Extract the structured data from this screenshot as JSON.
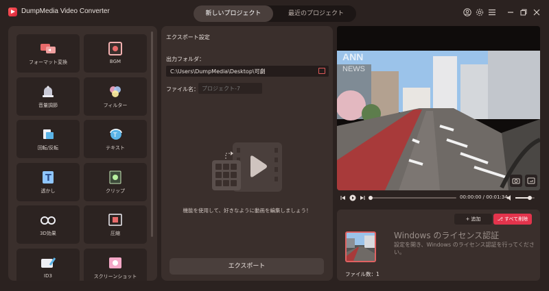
{
  "app": {
    "title": "DumpMedia Video Converter"
  },
  "tabs": [
    {
      "label": "新しいプロジェクト",
      "active": true
    },
    {
      "label": "最近のプロジェクト",
      "active": false
    }
  ],
  "window_icons": [
    "user-icon",
    "gear-icon",
    "menu-icon",
    "minimize-icon",
    "maximize-icon",
    "close-icon"
  ],
  "tools": [
    {
      "label": "フォーマット変換",
      "icon": "format-convert-icon"
    },
    {
      "label": "BGM",
      "icon": "bgm-icon"
    },
    {
      "label": "音量調節",
      "icon": "volume-bell-icon"
    },
    {
      "label": "フィルター",
      "icon": "filter-icon"
    },
    {
      "label": "回転/反転",
      "icon": "rotate-icon"
    },
    {
      "label": "テキスト",
      "icon": "text-icon"
    },
    {
      "label": "透かし",
      "icon": "watermark-icon"
    },
    {
      "label": "クリップ",
      "icon": "crop-icon"
    },
    {
      "label": "3D効果",
      "icon": "3d-glasses-icon"
    },
    {
      "label": "圧縮",
      "icon": "compress-icon"
    },
    {
      "label": "ID3",
      "icon": "id3-icon"
    },
    {
      "label": "スクリーンショット",
      "icon": "screenshot-icon"
    }
  ],
  "export": {
    "section_title": "エクスポート設定",
    "folder_label": "出力フォルダ：",
    "folder_path": "C:\\Users\\DumpMedia\\Desktop\\可劇",
    "filename_label": "ファイル名：",
    "filename_placeholder": "プロジェクト-7",
    "hint": "機能を使用して、好きなように動画を編集しましょう！",
    "button": "エクスポート"
  },
  "player": {
    "time": "00:00:00 / 00:01:34",
    "progress": 0.0,
    "volume": 0.75,
    "video_overlay": [
      "ANN",
      "NEWS"
    ]
  },
  "files": {
    "add_label": "+ 追加",
    "delete_all_label": "すべて削除",
    "count_label": "ファイル数：1",
    "watermark_title": "Windows のライセンス認証",
    "watermark_text": "設定を開き、Windows のライセンス認証を行ってくださ い。"
  },
  "colors": {
    "accent": "#e3344c",
    "panel": "#3a2f2c",
    "background": "#2b2220"
  }
}
